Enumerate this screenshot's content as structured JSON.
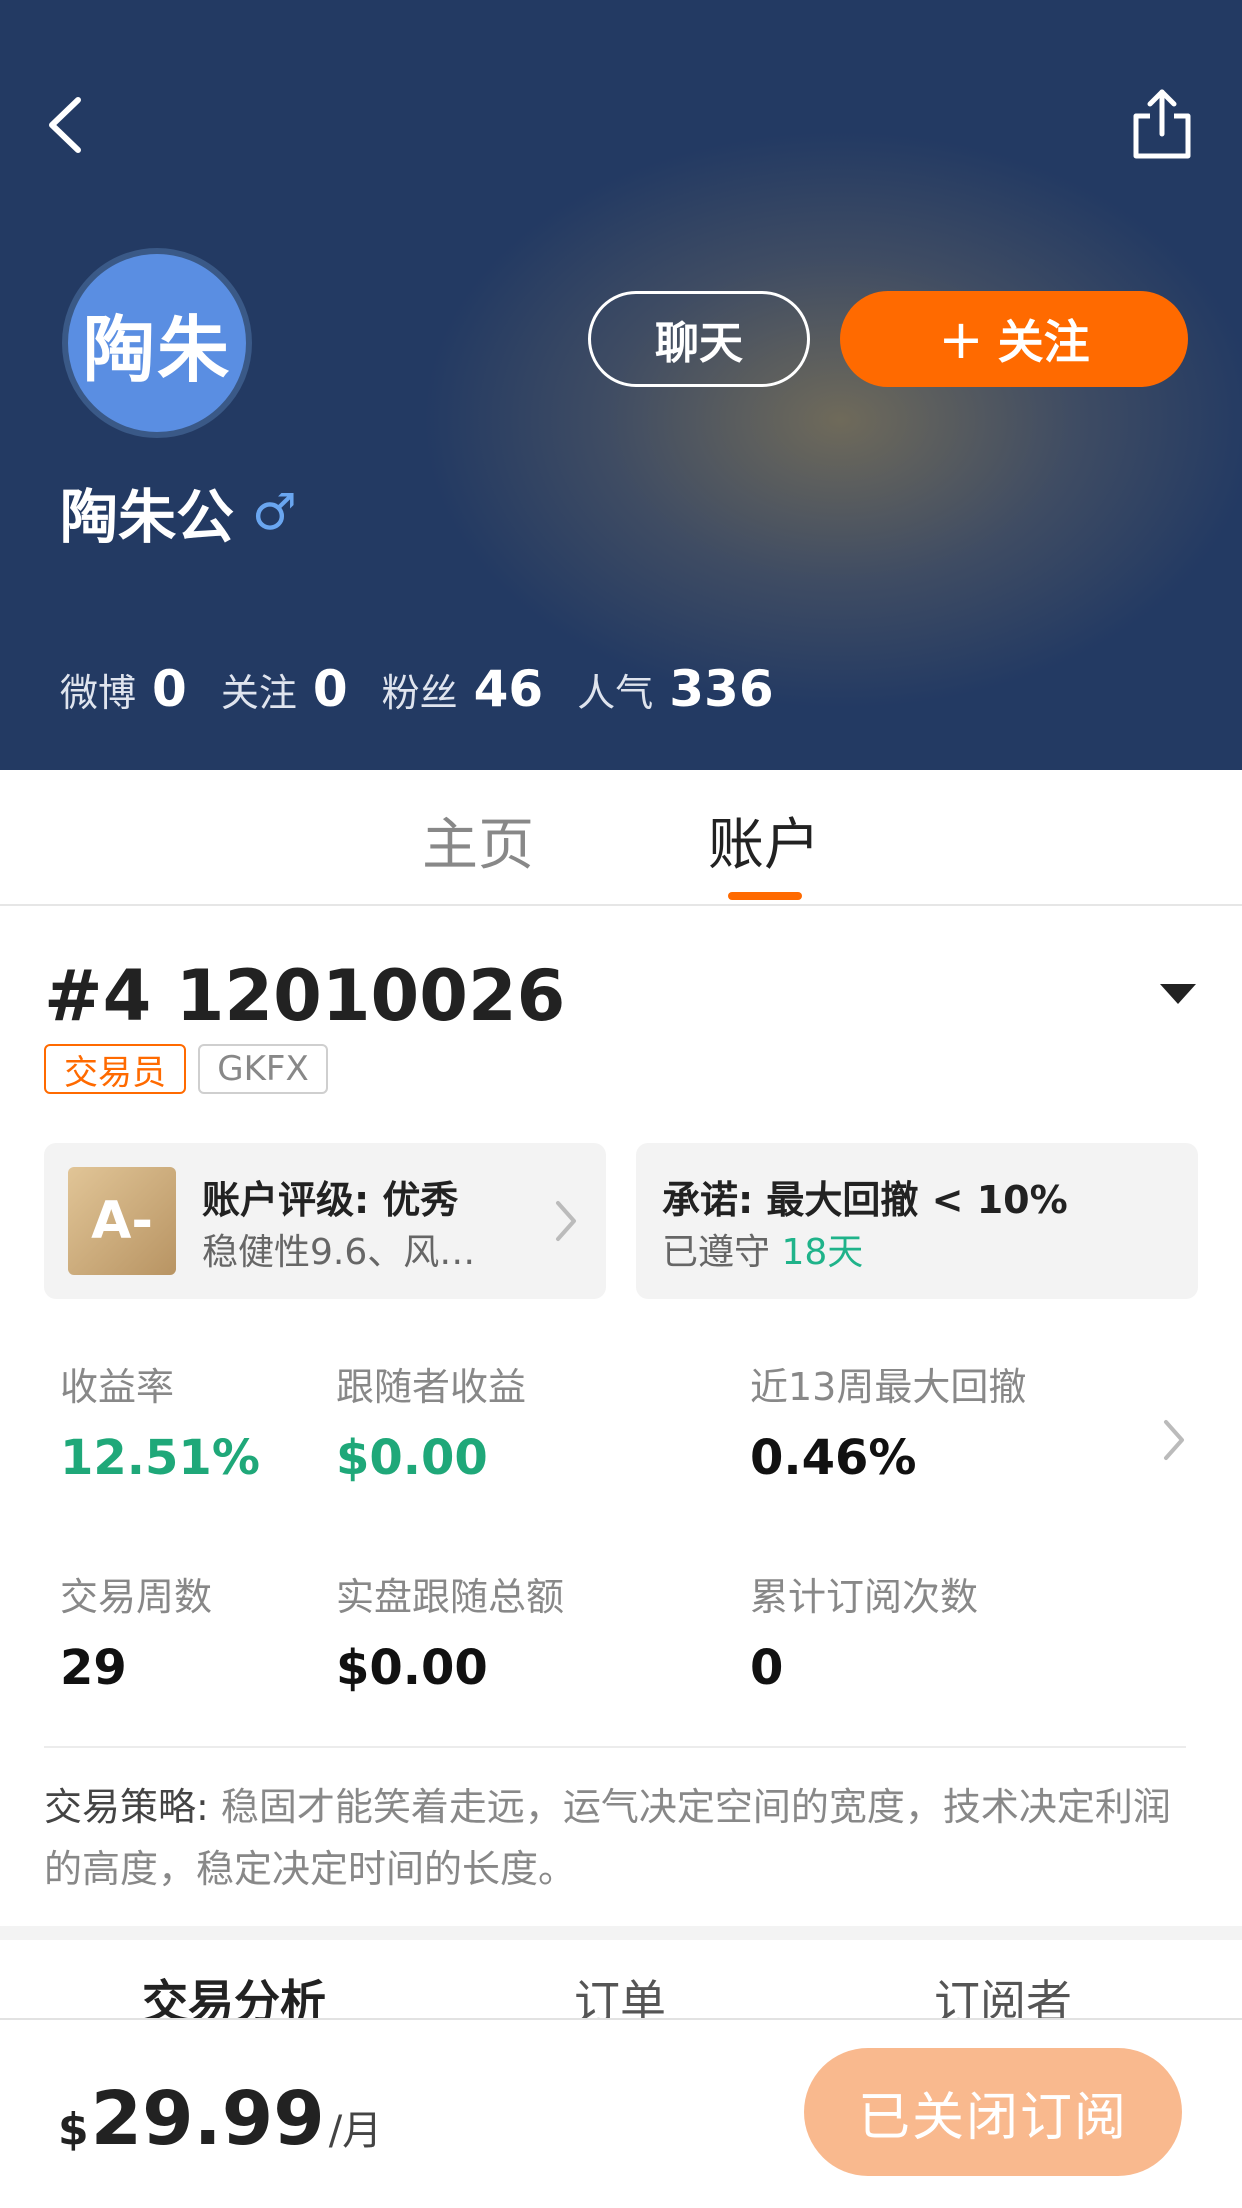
{
  "profile": {
    "avatar_text": "陶朱",
    "name": "陶朱公",
    "gender_symbol": "♂",
    "chat_label": "聊天",
    "follow_label": "关注",
    "follow_plus": "+",
    "stats": [
      {
        "label": "微博",
        "value": "0"
      },
      {
        "label": "关注",
        "value": "0"
      },
      {
        "label": "粉丝",
        "value": "46"
      },
      {
        "label": "人气",
        "value": "336"
      }
    ]
  },
  "tabs": {
    "home": "主页",
    "account": "账户",
    "active": "account"
  },
  "account": {
    "id": "#4 12010026",
    "badge_trader": "交易员",
    "badge_broker": "GKFX",
    "rating_grade": "A-",
    "rating_title": "账户评级: 优秀",
    "rating_sub": "稳健性9.6、风…",
    "promise_title": "承诺: 最大回撤 < 10%",
    "promise_prefix": "已遵守",
    "promise_days": "18天"
  },
  "metrics": [
    {
      "label": "收益率",
      "value": "12.51%",
      "color": "#1fa879"
    },
    {
      "label": "跟随者收益",
      "value": "$0.00",
      "color": "#1fa879"
    },
    {
      "label": "近13周最大回撤",
      "value": "0.46%",
      "color": "#111111"
    },
    {
      "label": "交易周数",
      "value": "29",
      "color": "#111111"
    },
    {
      "label": "实盘跟随总额",
      "value": "$0.00",
      "color": "#111111"
    },
    {
      "label": "累计订阅次数",
      "value": "0",
      "color": "#111111"
    }
  ],
  "strategy": {
    "label": "交易策略:",
    "text": " 稳固才能笑着走远，运气决定空间的宽度，技术决定利润的高度，稳定决定时间的长度。"
  },
  "subtabs": {
    "analysis": "交易分析",
    "orders": "订单",
    "subscribers": "订阅者"
  },
  "bottom": {
    "currency": "$",
    "price": "29.99",
    "unit": "/月",
    "button_label": "已关闭订阅"
  },
  "colors": {
    "accent": "#ff6a00",
    "positive": "#1fa879",
    "header_bg": "#233a63",
    "subscribe_disabled": "#f9b98e"
  },
  "icons": {
    "back": "chevron-left",
    "share": "share-box-arrow-up",
    "dropdown": "triangle-down",
    "chevron": "chevron-right"
  }
}
